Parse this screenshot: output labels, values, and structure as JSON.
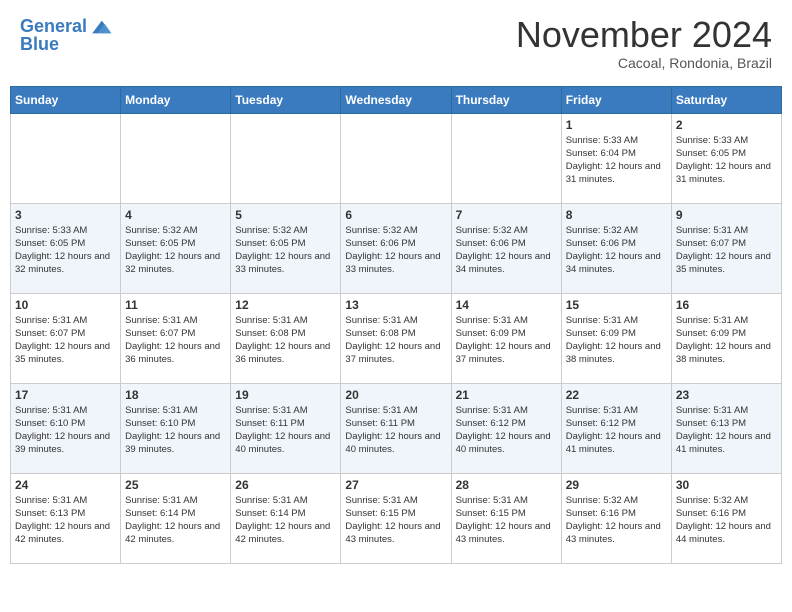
{
  "header": {
    "logo_line1": "General",
    "logo_line2": "Blue",
    "month": "November 2024",
    "location": "Cacoal, Rondonia, Brazil"
  },
  "weekdays": [
    "Sunday",
    "Monday",
    "Tuesday",
    "Wednesday",
    "Thursday",
    "Friday",
    "Saturday"
  ],
  "weeks": [
    [
      {
        "day": "",
        "info": ""
      },
      {
        "day": "",
        "info": ""
      },
      {
        "day": "",
        "info": ""
      },
      {
        "day": "",
        "info": ""
      },
      {
        "day": "",
        "info": ""
      },
      {
        "day": "1",
        "info": "Sunrise: 5:33 AM\nSunset: 6:04 PM\nDaylight: 12 hours and 31 minutes."
      },
      {
        "day": "2",
        "info": "Sunrise: 5:33 AM\nSunset: 6:05 PM\nDaylight: 12 hours and 31 minutes."
      }
    ],
    [
      {
        "day": "3",
        "info": "Sunrise: 5:33 AM\nSunset: 6:05 PM\nDaylight: 12 hours and 32 minutes."
      },
      {
        "day": "4",
        "info": "Sunrise: 5:32 AM\nSunset: 6:05 PM\nDaylight: 12 hours and 32 minutes."
      },
      {
        "day": "5",
        "info": "Sunrise: 5:32 AM\nSunset: 6:05 PM\nDaylight: 12 hours and 33 minutes."
      },
      {
        "day": "6",
        "info": "Sunrise: 5:32 AM\nSunset: 6:06 PM\nDaylight: 12 hours and 33 minutes."
      },
      {
        "day": "7",
        "info": "Sunrise: 5:32 AM\nSunset: 6:06 PM\nDaylight: 12 hours and 34 minutes."
      },
      {
        "day": "8",
        "info": "Sunrise: 5:32 AM\nSunset: 6:06 PM\nDaylight: 12 hours and 34 minutes."
      },
      {
        "day": "9",
        "info": "Sunrise: 5:31 AM\nSunset: 6:07 PM\nDaylight: 12 hours and 35 minutes."
      }
    ],
    [
      {
        "day": "10",
        "info": "Sunrise: 5:31 AM\nSunset: 6:07 PM\nDaylight: 12 hours and 35 minutes."
      },
      {
        "day": "11",
        "info": "Sunrise: 5:31 AM\nSunset: 6:07 PM\nDaylight: 12 hours and 36 minutes."
      },
      {
        "day": "12",
        "info": "Sunrise: 5:31 AM\nSunset: 6:08 PM\nDaylight: 12 hours and 36 minutes."
      },
      {
        "day": "13",
        "info": "Sunrise: 5:31 AM\nSunset: 6:08 PM\nDaylight: 12 hours and 37 minutes."
      },
      {
        "day": "14",
        "info": "Sunrise: 5:31 AM\nSunset: 6:09 PM\nDaylight: 12 hours and 37 minutes."
      },
      {
        "day": "15",
        "info": "Sunrise: 5:31 AM\nSunset: 6:09 PM\nDaylight: 12 hours and 38 minutes."
      },
      {
        "day": "16",
        "info": "Sunrise: 5:31 AM\nSunset: 6:09 PM\nDaylight: 12 hours and 38 minutes."
      }
    ],
    [
      {
        "day": "17",
        "info": "Sunrise: 5:31 AM\nSunset: 6:10 PM\nDaylight: 12 hours and 39 minutes."
      },
      {
        "day": "18",
        "info": "Sunrise: 5:31 AM\nSunset: 6:10 PM\nDaylight: 12 hours and 39 minutes."
      },
      {
        "day": "19",
        "info": "Sunrise: 5:31 AM\nSunset: 6:11 PM\nDaylight: 12 hours and 40 minutes."
      },
      {
        "day": "20",
        "info": "Sunrise: 5:31 AM\nSunset: 6:11 PM\nDaylight: 12 hours and 40 minutes."
      },
      {
        "day": "21",
        "info": "Sunrise: 5:31 AM\nSunset: 6:12 PM\nDaylight: 12 hours and 40 minutes."
      },
      {
        "day": "22",
        "info": "Sunrise: 5:31 AM\nSunset: 6:12 PM\nDaylight: 12 hours and 41 minutes."
      },
      {
        "day": "23",
        "info": "Sunrise: 5:31 AM\nSunset: 6:13 PM\nDaylight: 12 hours and 41 minutes."
      }
    ],
    [
      {
        "day": "24",
        "info": "Sunrise: 5:31 AM\nSunset: 6:13 PM\nDaylight: 12 hours and 42 minutes."
      },
      {
        "day": "25",
        "info": "Sunrise: 5:31 AM\nSunset: 6:14 PM\nDaylight: 12 hours and 42 minutes."
      },
      {
        "day": "26",
        "info": "Sunrise: 5:31 AM\nSunset: 6:14 PM\nDaylight: 12 hours and 42 minutes."
      },
      {
        "day": "27",
        "info": "Sunrise: 5:31 AM\nSunset: 6:15 PM\nDaylight: 12 hours and 43 minutes."
      },
      {
        "day": "28",
        "info": "Sunrise: 5:31 AM\nSunset: 6:15 PM\nDaylight: 12 hours and 43 minutes."
      },
      {
        "day": "29",
        "info": "Sunrise: 5:32 AM\nSunset: 6:16 PM\nDaylight: 12 hours and 43 minutes."
      },
      {
        "day": "30",
        "info": "Sunrise: 5:32 AM\nSunset: 6:16 PM\nDaylight: 12 hours and 44 minutes."
      }
    ]
  ]
}
